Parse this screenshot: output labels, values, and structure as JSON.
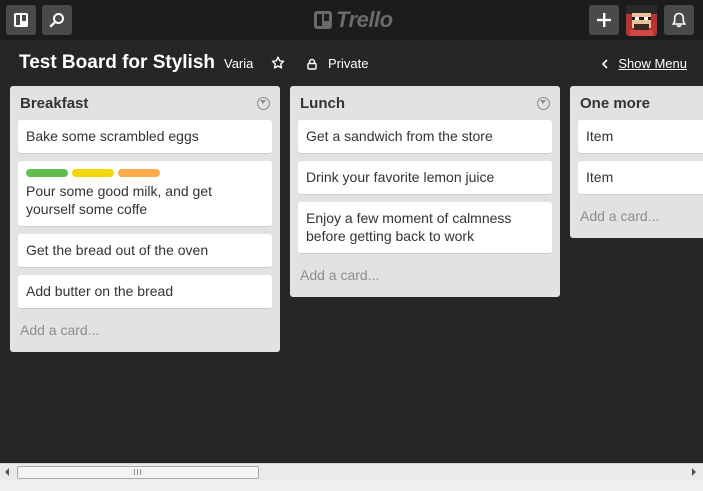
{
  "header": {
    "logo_text": "Trello",
    "icons": {
      "boards": "boards-icon",
      "search": "search-icon",
      "add": "plus-icon",
      "notifications": "bell-icon"
    }
  },
  "board": {
    "title": "Test Board for Stylish",
    "organization": "Varia",
    "visibility": "Private",
    "show_menu": "Show Menu"
  },
  "lists": [
    {
      "title": "Breakfast",
      "cards": [
        {
          "text": "Bake some scrambled eggs",
          "labels": []
        },
        {
          "text": "Pour some good milk, and get yourself some coffe",
          "labels": [
            "#61bd4f",
            "#f2d600",
            "#ffab4a"
          ]
        },
        {
          "text": "Get the bread out of the oven",
          "labels": []
        },
        {
          "text": "Add butter on the bread",
          "labels": []
        }
      ],
      "add_card": "Add a card..."
    },
    {
      "title": "Lunch",
      "cards": [
        {
          "text": "Get a sandwich from the store",
          "labels": []
        },
        {
          "text": "Drink your favorite lemon juice",
          "labels": []
        },
        {
          "text": "Enjoy a few moment of calmness before getting back to work",
          "labels": []
        }
      ],
      "add_card": "Add a card..."
    },
    {
      "title": "One more",
      "cards": [
        {
          "text": "Item",
          "labels": []
        },
        {
          "text": "Item",
          "labels": []
        }
      ],
      "add_card": "Add a card..."
    }
  ],
  "scrollbar": {
    "grip": "III"
  }
}
